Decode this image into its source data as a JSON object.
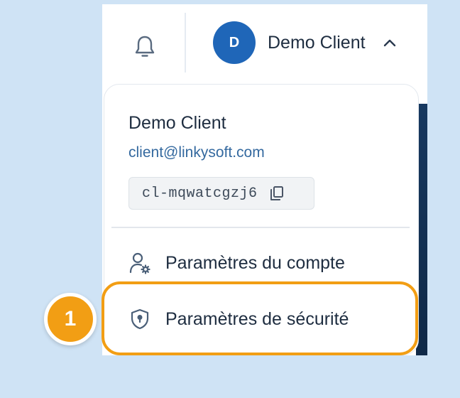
{
  "topbar": {
    "bell_icon": "bell-icon",
    "user": {
      "avatar_initial": "D",
      "name": "Demo Client",
      "chevron_icon": "chevron-up-icon"
    }
  },
  "dropdown": {
    "name": "Demo Client",
    "email": "client@linkysoft.com",
    "client_id": "cl-mqwatcgzj6",
    "copy_icon": "copy-icon",
    "items": [
      {
        "label": "Paramètres du compte",
        "icon": "user-gear-icon"
      },
      {
        "label": "Paramètres de sécurité",
        "icon": "shield-icon"
      }
    ]
  },
  "annotation": {
    "step_number": "1",
    "highlight_color": "#f29e14"
  },
  "colors": {
    "background": "#cfe3f5",
    "avatar": "#1f66b8",
    "email_text": "#34699f",
    "primary_text": "#1e2d40"
  }
}
